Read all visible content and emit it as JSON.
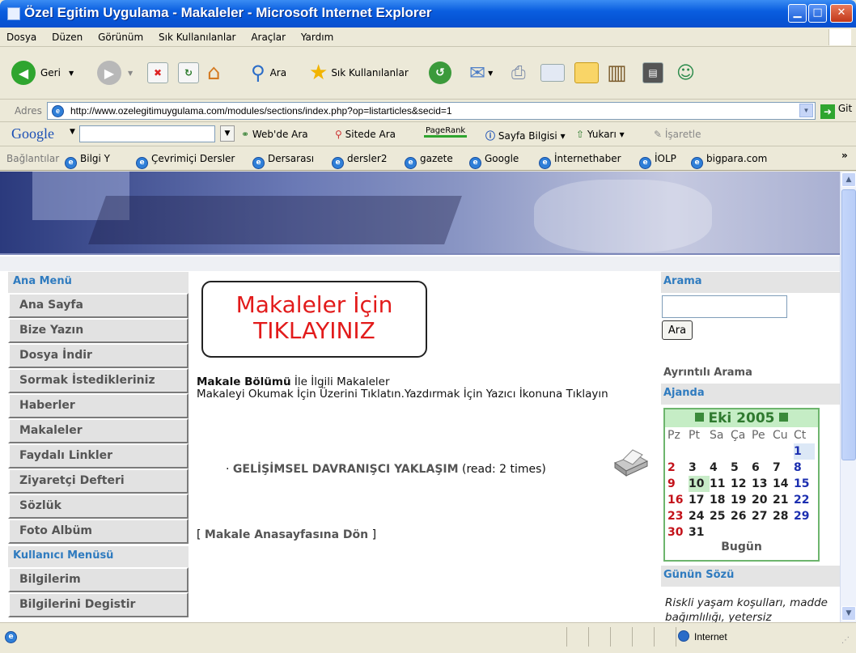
{
  "window": {
    "title": "Özel Egitim Uygulama - Makaleler - Microsoft Internet Explorer"
  },
  "menubar": {
    "items": [
      "Dosya",
      "Düzen",
      "Görünüm",
      "Sık Kullanılanlar",
      "Araçlar",
      "Yardım"
    ]
  },
  "toolbar": {
    "back_label": "Geri",
    "search_label": "Ara",
    "favorites_label": "Sık Kullanılanlar"
  },
  "addressbar": {
    "label": "Adres",
    "url": "http://www.ozelegitimuygulama.com/modules/sections/index.php?op=listarticles&secid=1",
    "go_label": "Git"
  },
  "googlebar": {
    "logo": "Google",
    "search_web": "Web'de Ara",
    "search_site": "Sitede Ara",
    "pagerank": "PageRank",
    "page_info": "Sayfa Bilgisi",
    "up": "Yukarı",
    "highlight": "İşaretle"
  },
  "linksbar": {
    "label": "Bağlantılar",
    "links": [
      "Bilgi Y",
      "Çevrimiçi Dersler",
      "Dersarası",
      "dersler2",
      "gazete",
      "Google",
      "İnternethaber",
      "İOLP",
      "bigpara.com"
    ]
  },
  "left": {
    "main_menu_title": "Ana Menü",
    "main_menu": [
      "Ana Sayfa",
      "Bize Yazın",
      "Dosya İndir",
      "Sormak İstedikleriniz",
      "Haberler",
      "Makaleler",
      "Faydalı Linkler",
      "Ziyaretçi Defteri",
      "Sözlük",
      "Foto Albüm"
    ],
    "user_menu_title": "Kullanıcı Menüsü",
    "user_menu": [
      "Bilgilerim",
      "Bilgilerini Degistir"
    ]
  },
  "center": {
    "promo_line1": "Makaleler İçin",
    "promo_line2": "TIKLAYINIZ",
    "section_bold": "Makale Bölümü",
    "section_rest": " İle İlgili Makaleler",
    "instructions": "Makaleyi Okumak İçin Üzerini Tıklatın.Yazdırmak İçin Yazıcı İkonuna Tıklayın",
    "article_bullet": "·",
    "article_title": "GELİŞİMSEL DAVRANIŞCI YAKLAŞIM",
    "article_reads": " (read: 2 times)",
    "back_open": "[ ",
    "back_link": "Makale Anasayfasına Dön",
    "back_close": " ]"
  },
  "right": {
    "search_title": "Arama",
    "search_button": "Ara",
    "advanced_search": "Ayrıntılı Arama",
    "agenda_title": "Ajanda",
    "calendar": {
      "month_label": "Eki 2005",
      "day_headers": [
        "Pz",
        "Pt",
        "Sa",
        "Ça",
        "Pe",
        "Cu",
        "Ct"
      ],
      "weeks": [
        [
          "",
          "",
          "",
          "",
          "",
          "",
          "1"
        ],
        [
          "2",
          "3",
          "4",
          "5",
          "6",
          "7",
          "8"
        ],
        [
          "9",
          "10",
          "11",
          "12",
          "13",
          "14",
          "15"
        ],
        [
          "16",
          "17",
          "18",
          "19",
          "20",
          "21",
          "22"
        ],
        [
          "23",
          "24",
          "25",
          "26",
          "27",
          "28",
          "29"
        ],
        [
          "30",
          "31",
          "",
          "",
          "",
          "",
          ""
        ]
      ],
      "today_label": "Bugün"
    },
    "quote_title": "Günün Sözü",
    "quote_text": "Riskli yaşam koşulları, madde bağımlılığı, yetersiz"
  },
  "statusbar": {
    "zone": "Internet"
  }
}
